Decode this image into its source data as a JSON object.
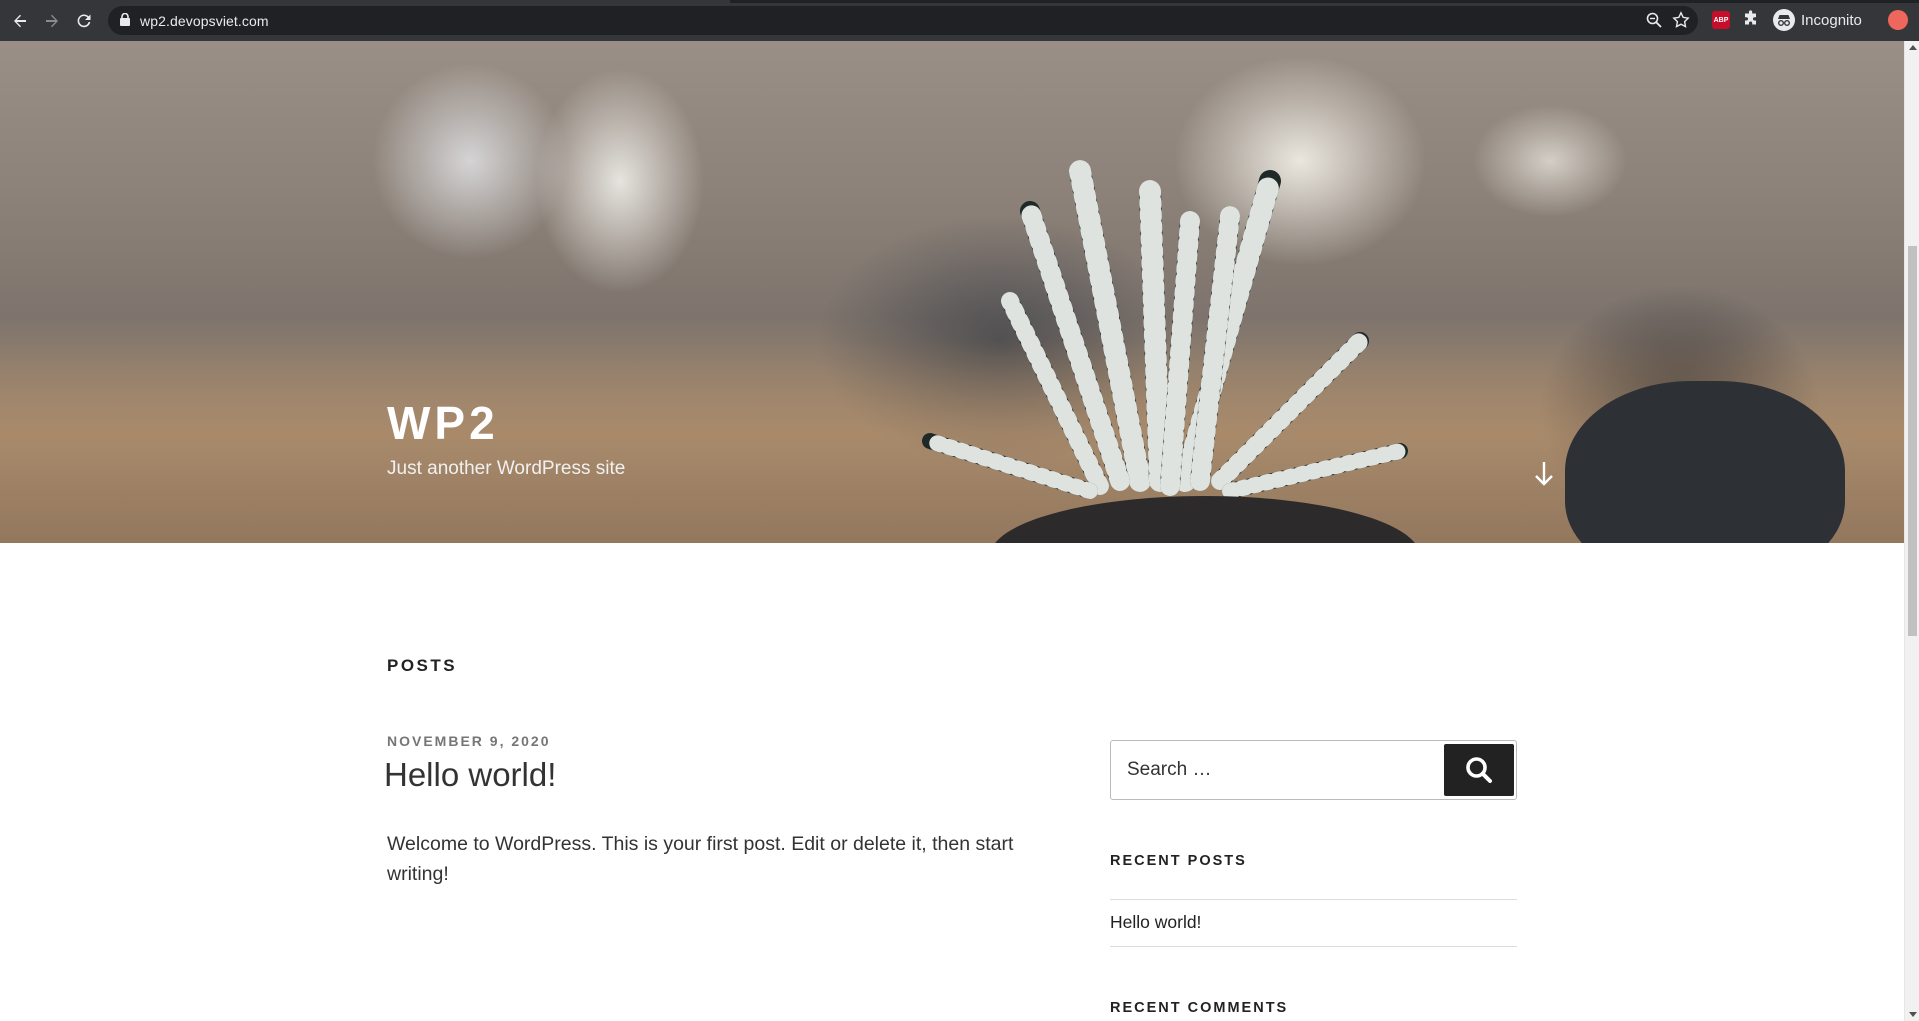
{
  "browser": {
    "url": "wp2.devopsviet.com",
    "incognito_label": "Incognito",
    "abp_label": "ABP"
  },
  "site": {
    "title": "WP2",
    "tagline": "Just another WordPress site"
  },
  "main": {
    "posts_heading": "POSTS",
    "post": {
      "date": "NOVEMBER 9, 2020",
      "title": "Hello world!",
      "excerpt": "Welcome to WordPress. This is your first post. Edit or delete it, then start writing!"
    }
  },
  "sidebar": {
    "search": {
      "placeholder": "Search …"
    },
    "recent_posts_title": "RECENT POSTS",
    "recent_posts": [
      "Hello world!"
    ],
    "recent_comments_title": "RECENT COMMENTS"
  },
  "icons": [
    "back-icon",
    "forward-icon",
    "reload-icon",
    "lock-icon",
    "zoom-icon",
    "star-icon",
    "puzzle-icon",
    "incognito-icon",
    "arrow-down-icon",
    "search-icon"
  ]
}
